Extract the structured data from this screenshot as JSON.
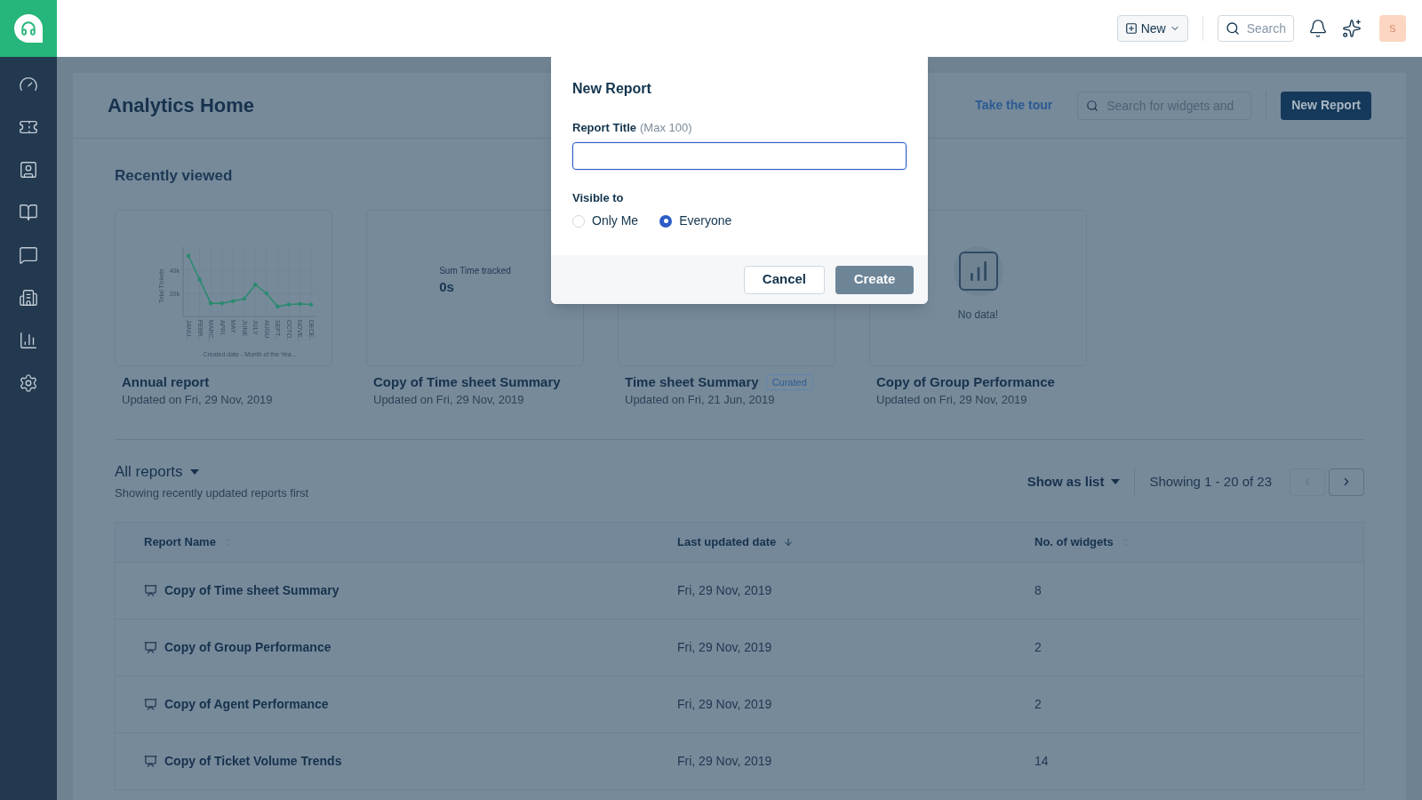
{
  "top_bar": {
    "new_button": "New",
    "search_button": "Search",
    "avatar": "S"
  },
  "page": {
    "title": "Analytics Home",
    "tour_link": "Take the tour",
    "search_placeholder": "Search for widgets and",
    "new_report_button": "New Report"
  },
  "recently_viewed": {
    "heading": "Recently viewed",
    "cards": [
      {
        "kind": "chart",
        "title": "Annual report",
        "updated": "Updated on Fri, 29 Nov, 2019",
        "chart_data": {
          "type": "line",
          "xlabel": "Created date - Month of the Yea...",
          "ylabel": "Total Tickets",
          "categories": [
            "JANU..",
            "FEBR..",
            "MARC..",
            "APRI..",
            "MAY",
            "JUNE",
            "JULY",
            "AUGU..",
            "SEPT..",
            "OCTO..",
            "NOVE..",
            "DECE.."
          ],
          "series": [
            {
              "color": "#2a8a6e",
              "values": [
                52500,
                32000,
                11400,
                11400,
                13300,
                15300,
                27500,
                20000,
                8600,
                10300,
                10800,
                10300
              ]
            }
          ],
          "ylim": [
            0,
            60000
          ],
          "yticks": [
            {
              "value": 20000,
              "label": "20k"
            },
            {
              "value": 40000,
              "label": "40k"
            }
          ]
        }
      },
      {
        "kind": "metric",
        "title": "Copy of Time sheet Summary",
        "updated": "Updated on Fri, 29 Nov, 2019",
        "metric_label": "Sum Time tracked",
        "metric_value": "0s"
      },
      {
        "kind": "blank",
        "title": "Time sheet Summary",
        "badge": "Curated",
        "updated": "Updated on Fri, 21 Jun, 2019"
      },
      {
        "kind": "no_data",
        "title": "Copy of Group Performance",
        "updated": "Updated on Fri, 29 Nov, 2019",
        "message": "No data!"
      }
    ]
  },
  "all_reports": {
    "heading": "All reports",
    "subtitle": "Showing recently updated reports first",
    "view_toggle": "Show as list",
    "pagination": "Showing 1 - 20 of 23",
    "prev_disabled": true,
    "next_disabled": false,
    "table": {
      "columns": [
        {
          "label": "Report Name",
          "sorted": false
        },
        {
          "label": "Last updated date",
          "sorted": true
        },
        {
          "label": "No. of widgets",
          "sorted": false
        }
      ],
      "rows": [
        {
          "name": "Copy of Time sheet Summary",
          "updated": "Fri, 29 Nov, 2019",
          "widgets": "8"
        },
        {
          "name": "Copy of Group Performance",
          "updated": "Fri, 29 Nov, 2019",
          "widgets": "2"
        },
        {
          "name": "Copy of Agent Performance",
          "updated": "Fri, 29 Nov, 2019",
          "widgets": "2"
        },
        {
          "name": "Copy of Ticket Volume Trends",
          "updated": "Fri, 29 Nov, 2019",
          "widgets": "14"
        }
      ]
    }
  },
  "modal": {
    "title": "New Report",
    "field_label": "Report Title",
    "field_hint": "(Max 100)",
    "visible_label": "Visible to",
    "options": [
      {
        "label": "Only Me",
        "selected": false
      },
      {
        "label": "Everyone",
        "selected": true
      }
    ],
    "cancel_button": "Cancel",
    "create_button": {
      "label": "Create",
      "disabled": true
    }
  }
}
